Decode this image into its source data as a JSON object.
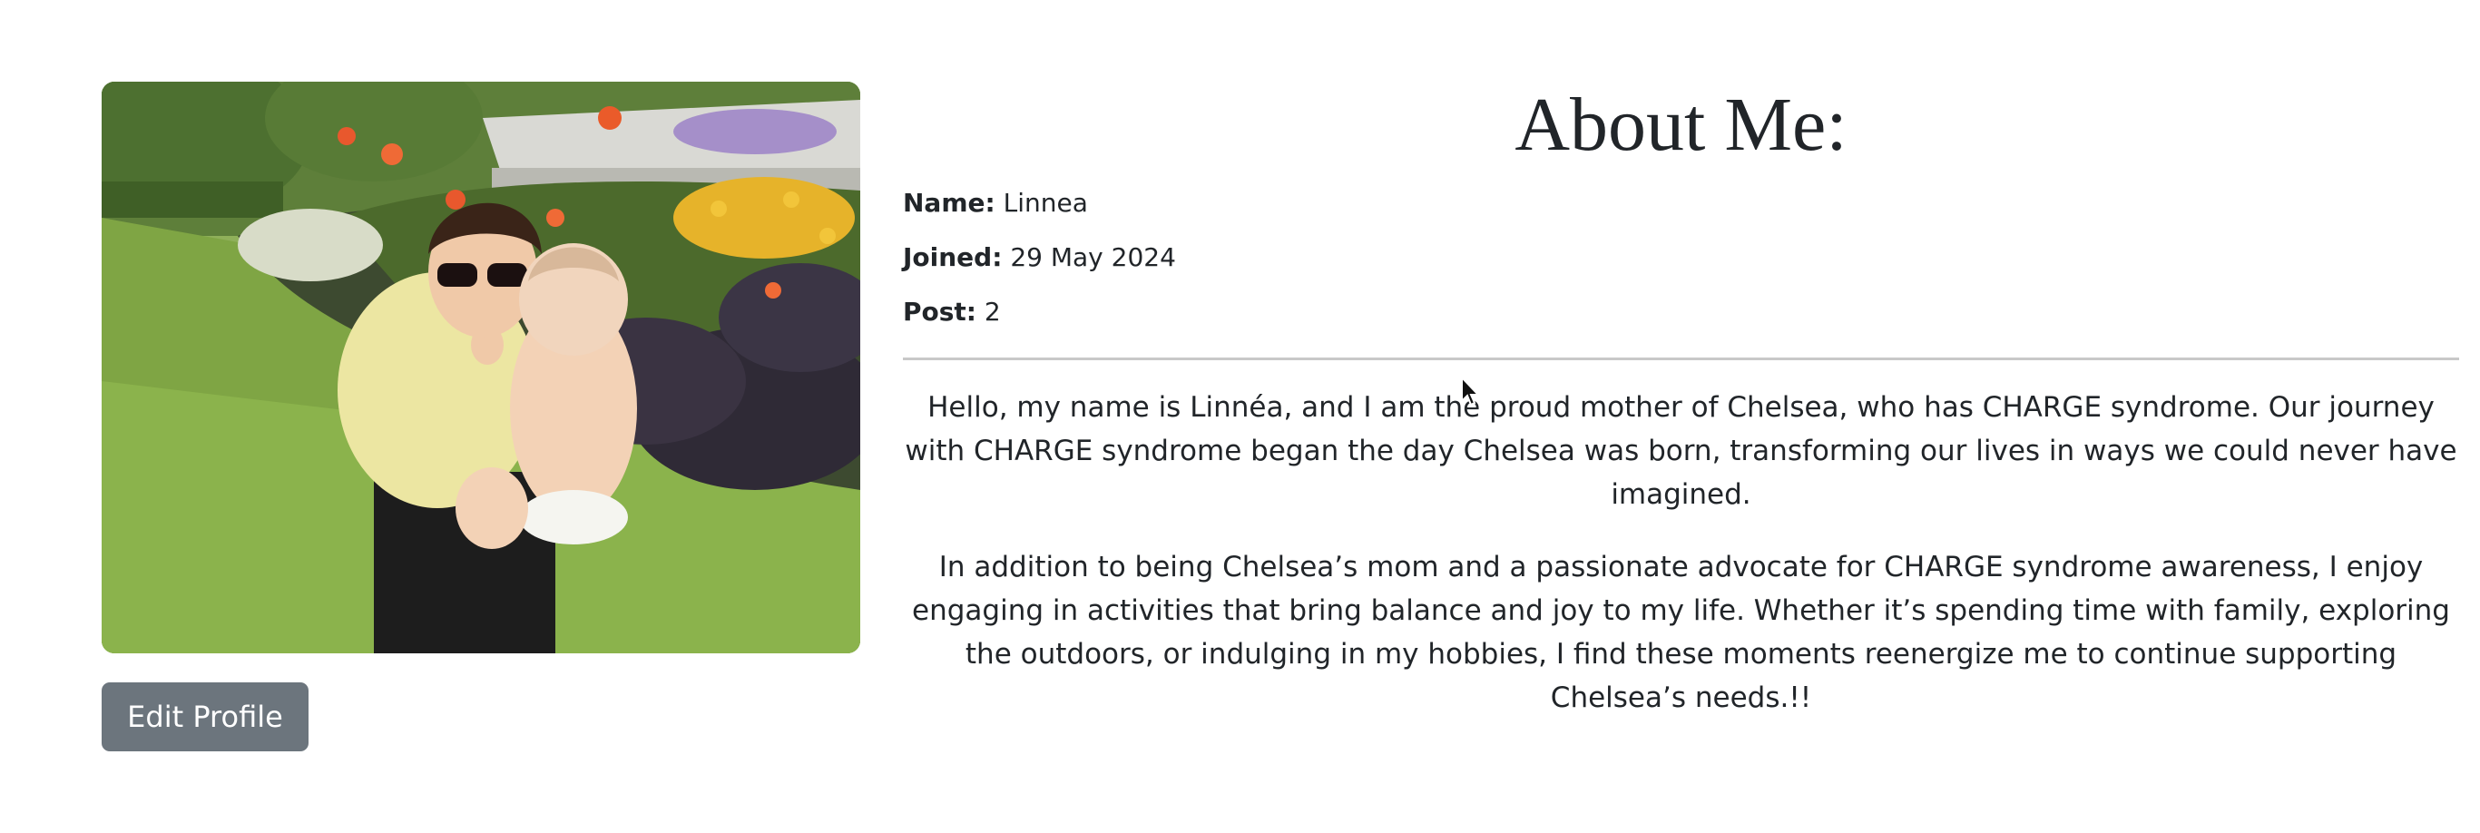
{
  "profile": {
    "photo_alt": "Profile photo",
    "edit_button": "Edit Profile"
  },
  "about": {
    "title": "About Me:",
    "name_label": "Name:",
    "name_value": "Linnea",
    "joined_label": "Joined:",
    "joined_value": "29 May 2024",
    "post_label": "Post:",
    "post_value": "2",
    "bio": [
      "Hello, my name is Linnéa, and I am the proud mother of Chelsea, who has CHARGE syndrome. Our journey with CHARGE syndrome began the day Chelsea was born, transforming our lives in ways we could never have imagined.",
      "In addition to being Chelsea’s mom and a passionate advocate for CHARGE syndrome awareness, I enjoy engaging in activities that bring balance and joy to my life. Whether it’s spending time with family, exploring the outdoors, or indulging in my hobbies, I find these moments reenergize me to continue supporting Chelsea’s needs.!!"
    ]
  },
  "colors": {
    "button_bg": "#6c757d",
    "button_text": "#ffffff",
    "divider": "#c8c8c8",
    "text": "#212529"
  }
}
